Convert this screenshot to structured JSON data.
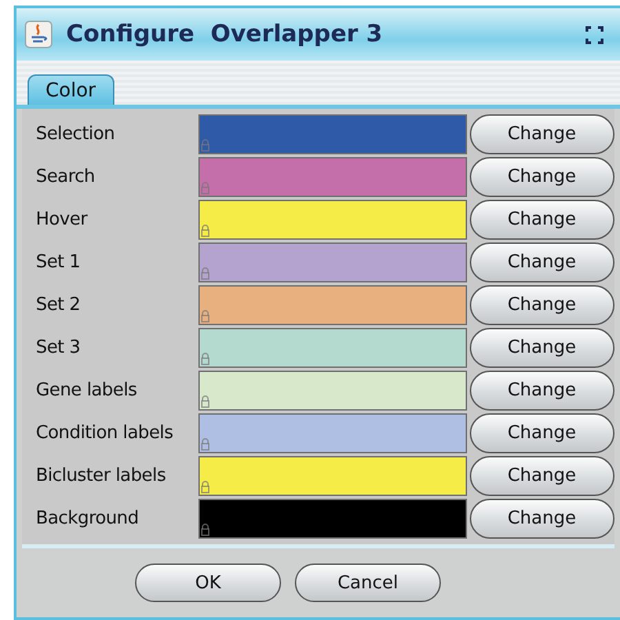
{
  "window": {
    "title": "Configure  Overlapper 3"
  },
  "tabs": [
    {
      "label": "Color",
      "selected": true
    }
  ],
  "colors": [
    {
      "label": "Selection",
      "color": "#2f5aa8",
      "button": "Change"
    },
    {
      "label": "Search",
      "color": "#c46fa9",
      "button": "Change"
    },
    {
      "label": "Hover",
      "color": "#f5ec48",
      "button": "Change"
    },
    {
      "label": "Set 1",
      "color": "#b5a3cf",
      "button": "Change"
    },
    {
      "label": "Set 2",
      "color": "#e9b07f",
      "button": "Change"
    },
    {
      "label": "Set 3",
      "color": "#b4d9cf",
      "button": "Change"
    },
    {
      "label": "Gene labels",
      "color": "#d8e8cb",
      "button": "Change"
    },
    {
      "label": "Condition labels",
      "color": "#aebfe3",
      "button": "Change"
    },
    {
      "label": "Bicluster labels",
      "color": "#f5ec48",
      "button": "Change"
    },
    {
      "label": "Background",
      "color": "#000000",
      "button": "Change"
    }
  ],
  "buttons": [
    "OK",
    "Cancel"
  ]
}
